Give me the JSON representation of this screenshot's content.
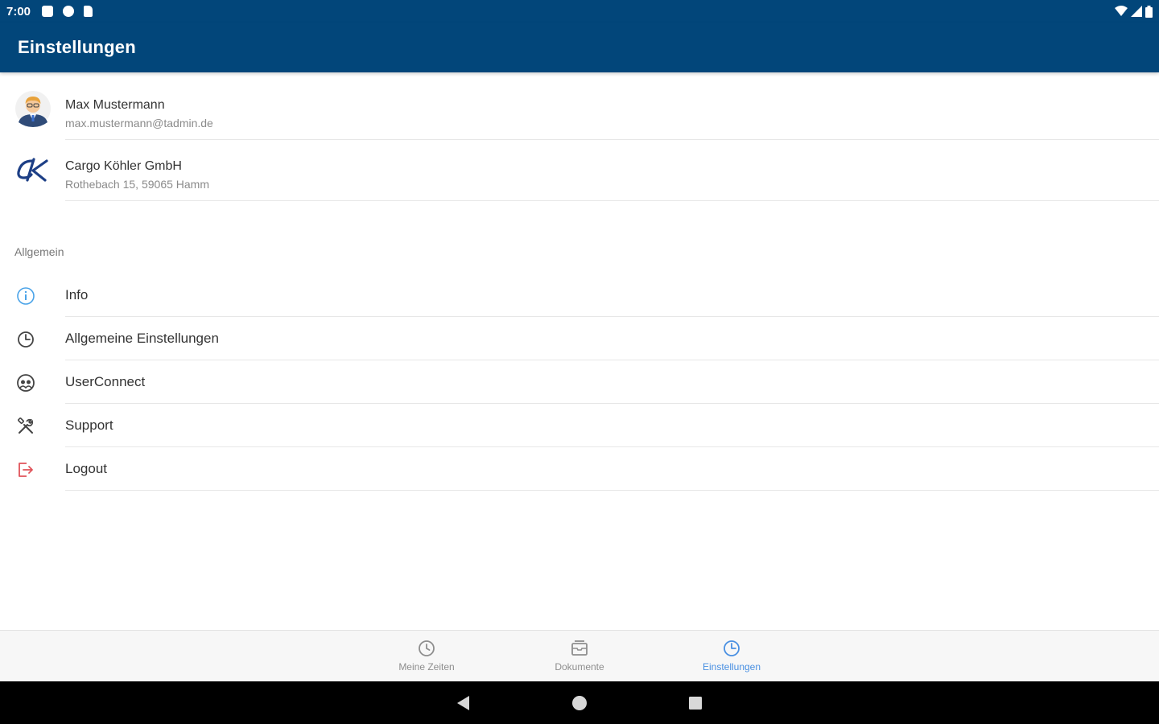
{
  "status_bar": {
    "time": "7:00",
    "icons": [
      "notification-icon",
      "app-icon",
      "sd-card-icon"
    ],
    "right_icons": [
      "wifi-icon",
      "signal-icon",
      "battery-icon"
    ]
  },
  "app_bar": {
    "title": "Einstellungen",
    "color": "#02467a"
  },
  "account": {
    "user": {
      "name": "Max Mustermann",
      "email": "max.mustermann@tadmin.de",
      "icon": "avatar"
    },
    "company": {
      "name": "Cargo Köhler GmbH",
      "address": "Rothebach 15, 59065 Hamm",
      "icon": "company-logo"
    }
  },
  "section": {
    "label": "Allgemein"
  },
  "menu": [
    {
      "id": "info",
      "label": "Info",
      "icon": "info-icon",
      "color": "#4aa3e8"
    },
    {
      "id": "general-settings",
      "label": "Allgemeine Einstellungen",
      "icon": "settings-icon",
      "color": "#444444"
    },
    {
      "id": "userconnect",
      "label": "UserConnect",
      "icon": "userconnect-icon",
      "color": "#444444"
    },
    {
      "id": "support",
      "label": "Support",
      "icon": "tools-icon",
      "color": "#444444"
    },
    {
      "id": "logout",
      "label": "Logout",
      "icon": "logout-icon",
      "color": "#e0535a"
    }
  ],
  "bottom_nav": {
    "items": [
      {
        "id": "times",
        "label": "Meine Zeiten",
        "icon": "clock-icon",
        "active": false
      },
      {
        "id": "documents",
        "label": "Dokumente",
        "icon": "document-icon",
        "active": false
      },
      {
        "id": "settings",
        "label": "Einstellungen",
        "icon": "settings-icon",
        "active": true
      }
    ],
    "active_color": "#4a90e2",
    "inactive_color": "#8e8e8e"
  },
  "system_nav": {
    "buttons": [
      "back-icon",
      "home-icon",
      "recents-icon"
    ]
  }
}
